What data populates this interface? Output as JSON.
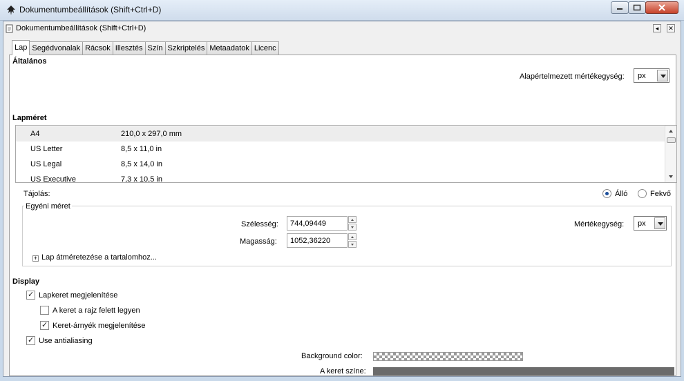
{
  "window": {
    "title": "Dokumentumbeállítások (Shift+Ctrl+D)"
  },
  "dock": {
    "title": "Dokumentumbeállítások (Shift+Ctrl+D)",
    "btn_collapse": "◂",
    "btn_close": "✕"
  },
  "tabs": [
    "Lap",
    "Segédvonalak",
    "Rácsok",
    "Illesztés",
    "Szín",
    "Szkriptelés",
    "Metaadatok",
    "Licenc"
  ],
  "general": {
    "heading": "Általános",
    "default_units_label": "Alapértelmezett mértékegység:",
    "default_units_value": "px"
  },
  "page_size": {
    "heading": "Lapméret",
    "rows": [
      {
        "name": "A4",
        "size": "210,0 x 297,0 mm"
      },
      {
        "name": "US Letter",
        "size": "8,5 x 11,0 in"
      },
      {
        "name": "US Legal",
        "size": "8,5 x 14,0 in"
      },
      {
        "name": "US Executive",
        "size": "7,3 x 10,5 in"
      }
    ],
    "selected_index": 0,
    "orientation_label": "Tájolás:",
    "portrait_label": "Álló",
    "landscape_label": "Fekvő",
    "orientation": "portrait"
  },
  "custom_size": {
    "legend": "Egyéni méret",
    "width_label": "Szélesség:",
    "width_value": "744,09449",
    "height_label": "Magasság:",
    "height_value": "1052,36220",
    "units_label": "Mértékegység:",
    "units_value": "px",
    "resize_label": "Lap átméretezése a tartalomhoz...",
    "expander_symbol": "+"
  },
  "display": {
    "heading": "Display",
    "show_border_label": "Lapkeret megjelenítése",
    "show_border": true,
    "border_on_top_label": "A keret a rajz felett legyen",
    "border_on_top": false,
    "show_shadow_label": "Keret-árnyék megjelenítése",
    "show_shadow": true,
    "antialias_label": "Use antialiasing",
    "antialias": true,
    "background_color_label": "Background color:",
    "border_color_label": "A keret színe:",
    "border_color": "#6b6b6b"
  }
}
